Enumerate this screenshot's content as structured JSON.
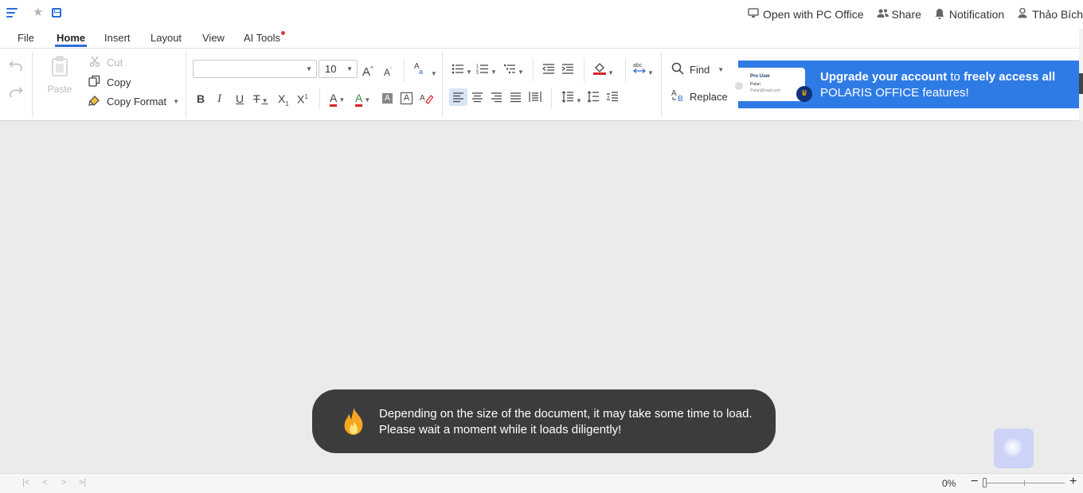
{
  "header": {
    "right_items": [
      {
        "label": "Open with PC Office",
        "icon": "monitor-icon"
      },
      {
        "label": "Share",
        "icon": "share-users-icon"
      },
      {
        "label": "Notification",
        "icon": "bell-icon"
      },
      {
        "label": "Thảo Bích",
        "icon": "user-icon"
      }
    ]
  },
  "tabs": [
    "File",
    "Home",
    "Insert",
    "Layout",
    "View",
    "AI Tools"
  ],
  "active_tab": "Home",
  "ribbon": {
    "paste_label": "Paste",
    "cut_label": "Cut",
    "copy_label": "Copy",
    "copy_format_label": "Copy Format",
    "font_name": "",
    "font_size": "10",
    "find_label": "Find",
    "replace_label": "Replace"
  },
  "banner": {
    "card_title": "Pro User",
    "card_name": "Polari",
    "card_email": "Polari@mail.com",
    "msg_bold1": "Upgrade your account",
    "msg_mid": " to ",
    "msg_bold2": "freely access all",
    "msg_line2": "POLARIS OFFICE features!"
  },
  "toast": {
    "line1": "Depending on the size of the document, it may take some time to load.",
    "line2": "Please wait a moment while it loads diligently!"
  },
  "status": {
    "zoom": "0%"
  },
  "colors": {
    "accent": "#2a6cd6",
    "banner_bg": "#2f7be5",
    "toast_bg": "#3c3c3c",
    "canvas_bg": "#ebebeb"
  }
}
